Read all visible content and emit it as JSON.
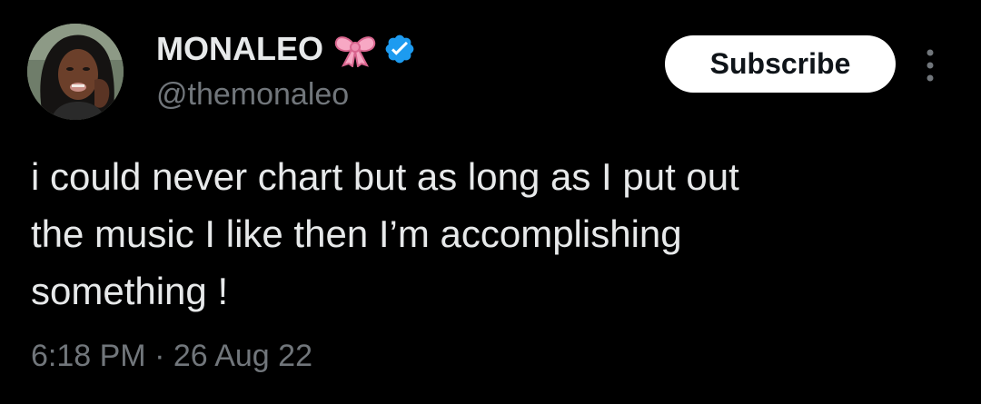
{
  "author": {
    "display_name": "MONALEO",
    "handle": "@themonaleo",
    "emoji_icon": "pink-bow-icon",
    "verified_icon": "verified-badge-icon",
    "verified_color": "#1d9bf0",
    "bow_color": "#f7a8c4"
  },
  "actions": {
    "subscribe_label": "Subscribe",
    "more_icon": "more-vertical-icon"
  },
  "tweet": {
    "text": "i could never chart but as long as I put out\nthe music I like then I’m accomplishing\nsomething !",
    "timestamp": "6:18 PM · 26 Aug 22"
  },
  "colors": {
    "background": "#000000",
    "primary_text": "#e7e9ea",
    "secondary_text": "#71767b",
    "button_bg": "#ffffff",
    "button_text": "#0f1419"
  }
}
